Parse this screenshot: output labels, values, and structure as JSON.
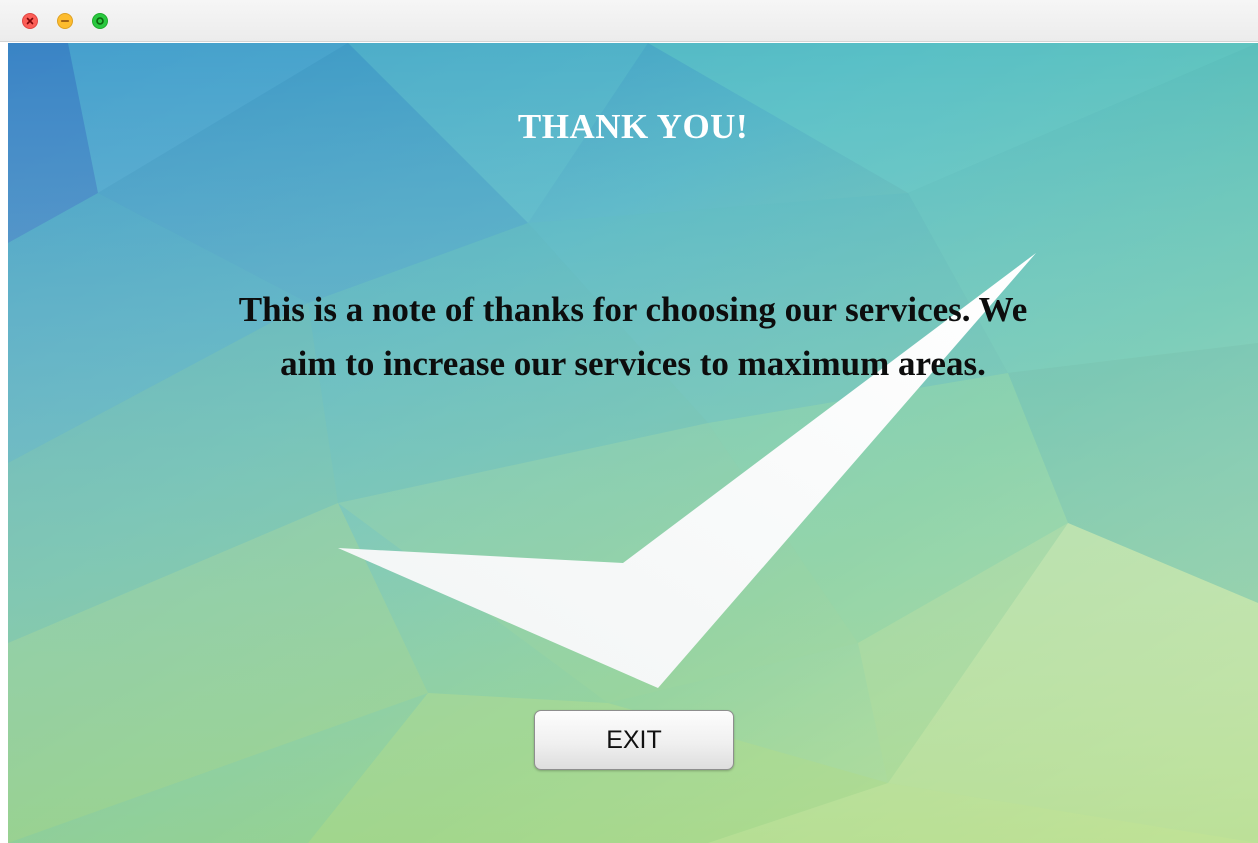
{
  "window": {
    "controls": [
      {
        "name": "close",
        "color": "#fc5e57"
      },
      {
        "name": "minimize",
        "color": "#fdbc2e"
      },
      {
        "name": "maximize",
        "color": "#2ac840"
      }
    ]
  },
  "dialog": {
    "title": "THANK YOU!",
    "message": "This is a note of thanks for choosing our services. We aim to increase our services to maximum areas.",
    "exit_label": "EXIT"
  },
  "background": {
    "graphic": "checkmark-icon",
    "colors": {
      "top_left": "#3e8fc9",
      "top_right": "#5ccbc6",
      "bottom_left": "#8fce82",
      "bottom_right": "#d4ecc0",
      "checkmark": "#ffffff"
    }
  }
}
